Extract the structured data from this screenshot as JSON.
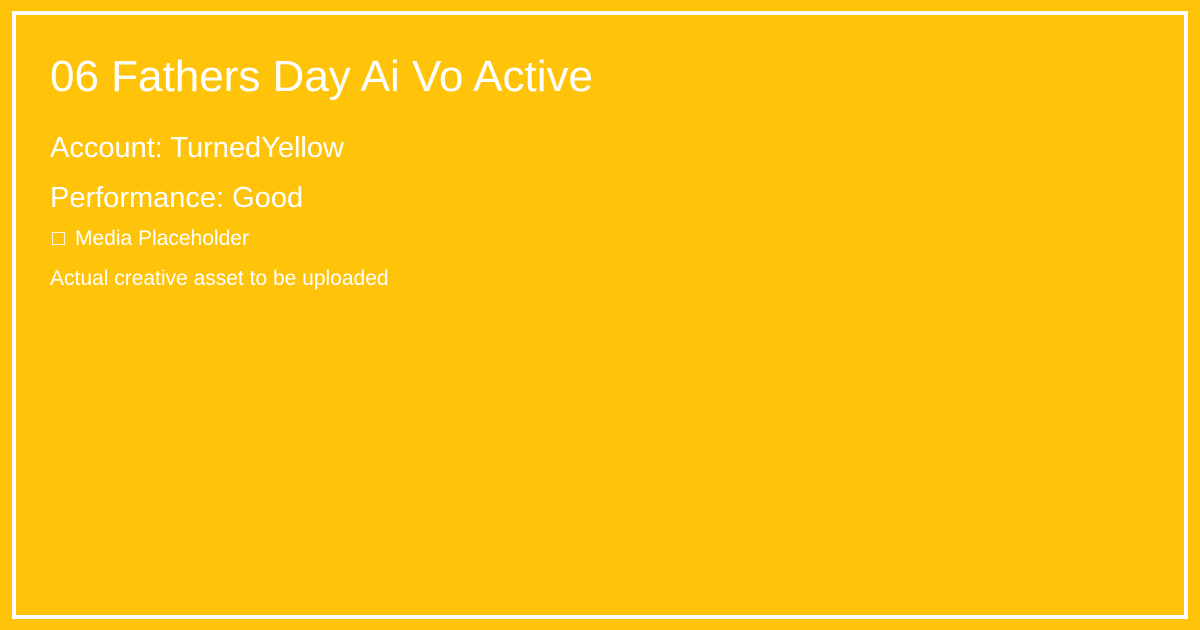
{
  "card": {
    "title": "06 Fathers Day Ai Vo Active",
    "account_line": "Account: TurnedYellow",
    "performance_line": "Performance: Good",
    "media_icon": "media-placeholder-icon",
    "media_label": "Media Placeholder",
    "note": "Actual creative asset to be uploaded"
  },
  "colors": {
    "background": "#FFC40A",
    "text": "#FFFFFF",
    "border": "#FFFFFF"
  }
}
